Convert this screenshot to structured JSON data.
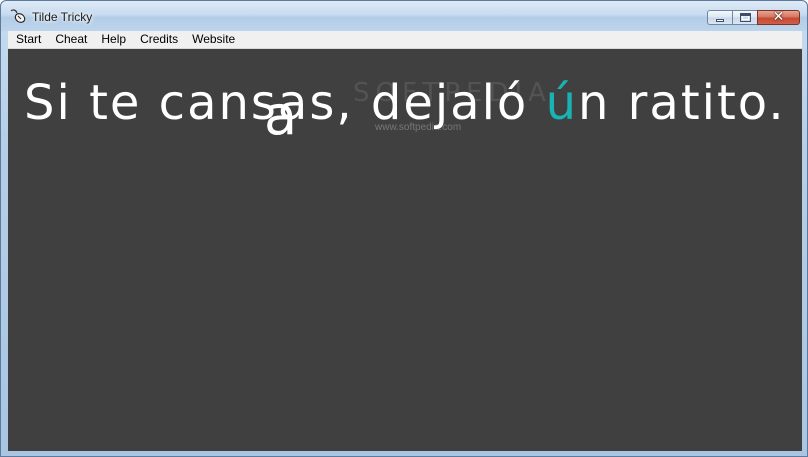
{
  "window": {
    "title": "Tilde Tricky",
    "icon": "mouse-icon",
    "controls": [
      "minimize",
      "maximize",
      "close"
    ]
  },
  "menu": {
    "items": [
      "Start",
      "Cheat",
      "Help",
      "Credits",
      "Website"
    ]
  },
  "game": {
    "sentence_before_accent": "Si te cansas, dejaló ",
    "accent_char": "ú",
    "sentence_after_accent": "n ratito.",
    "falling_letter": "a",
    "text_color": "#ffffff",
    "accent_color": "#19b3b3",
    "background_color": "#404040"
  },
  "watermark": {
    "brand": "SOFTPEDIA",
    "url": "www.softpedia.com"
  }
}
